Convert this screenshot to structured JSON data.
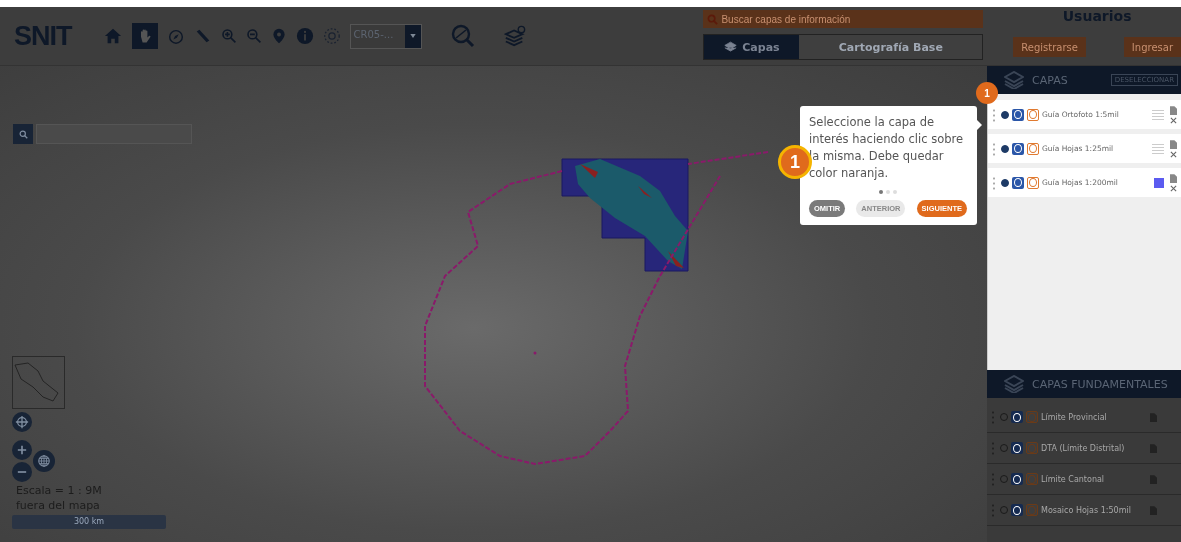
{
  "toolbar": {
    "logo": "SNIT",
    "crs_select": {
      "value": "CR05-..."
    }
  },
  "search": {
    "placeholder": "Buscar capas de información"
  },
  "tabs": [
    {
      "label": "Capas",
      "selected": true
    },
    {
      "label": "Cartografía Base",
      "selected": false
    }
  ],
  "users": {
    "title": "Usuarios",
    "buttons": [
      "Registrarse",
      "Ingresar"
    ]
  },
  "map": {
    "scale": "Escala = 1 : 9M",
    "location": "fuera del mapa",
    "scale_bar": "300 km"
  },
  "layers_panel": {
    "title": "CAPAS",
    "deselect": "DESELECCIONAR",
    "layers": [
      {
        "name": "Guía Ortofoto 1:5mil",
        "active": true,
        "kind": "thumbnail"
      },
      {
        "name": "Guía Hojas 1:25mil",
        "active": true,
        "kind": "thumbnail"
      },
      {
        "name": "Guía Hojas 1:200mil",
        "active": true,
        "kind": "swatch"
      }
    ]
  },
  "base_panel": {
    "title": "CAPAS FUNDAMENTALES",
    "layers": [
      {
        "name": "Límite Provincial",
        "active": false
      },
      {
        "name": "DTA (Límite Distrital)",
        "active": false
      },
      {
        "name": "Límite Cantonal",
        "active": false
      },
      {
        "name": "Mosaico Hojas 1:50mil",
        "active": false
      }
    ]
  },
  "tour": {
    "text": "Seleccione la capa de interés haciendo clic sobre la misma. Debe quedar color naranja.",
    "steps": [
      {
        "selected": true
      },
      {
        "selected": false
      },
      {
        "selected": false
      }
    ],
    "buttons": [
      {
        "label": "OMITIR",
        "kind": "skip",
        "disabled": false
      },
      {
        "label": "ANTERIOR",
        "kind": "prev",
        "disabled": true
      },
      {
        "label": "SIGUIENTE",
        "kind": "next",
        "disabled": false
      }
    ],
    "step_badge": "1",
    "target_badge": "1"
  }
}
